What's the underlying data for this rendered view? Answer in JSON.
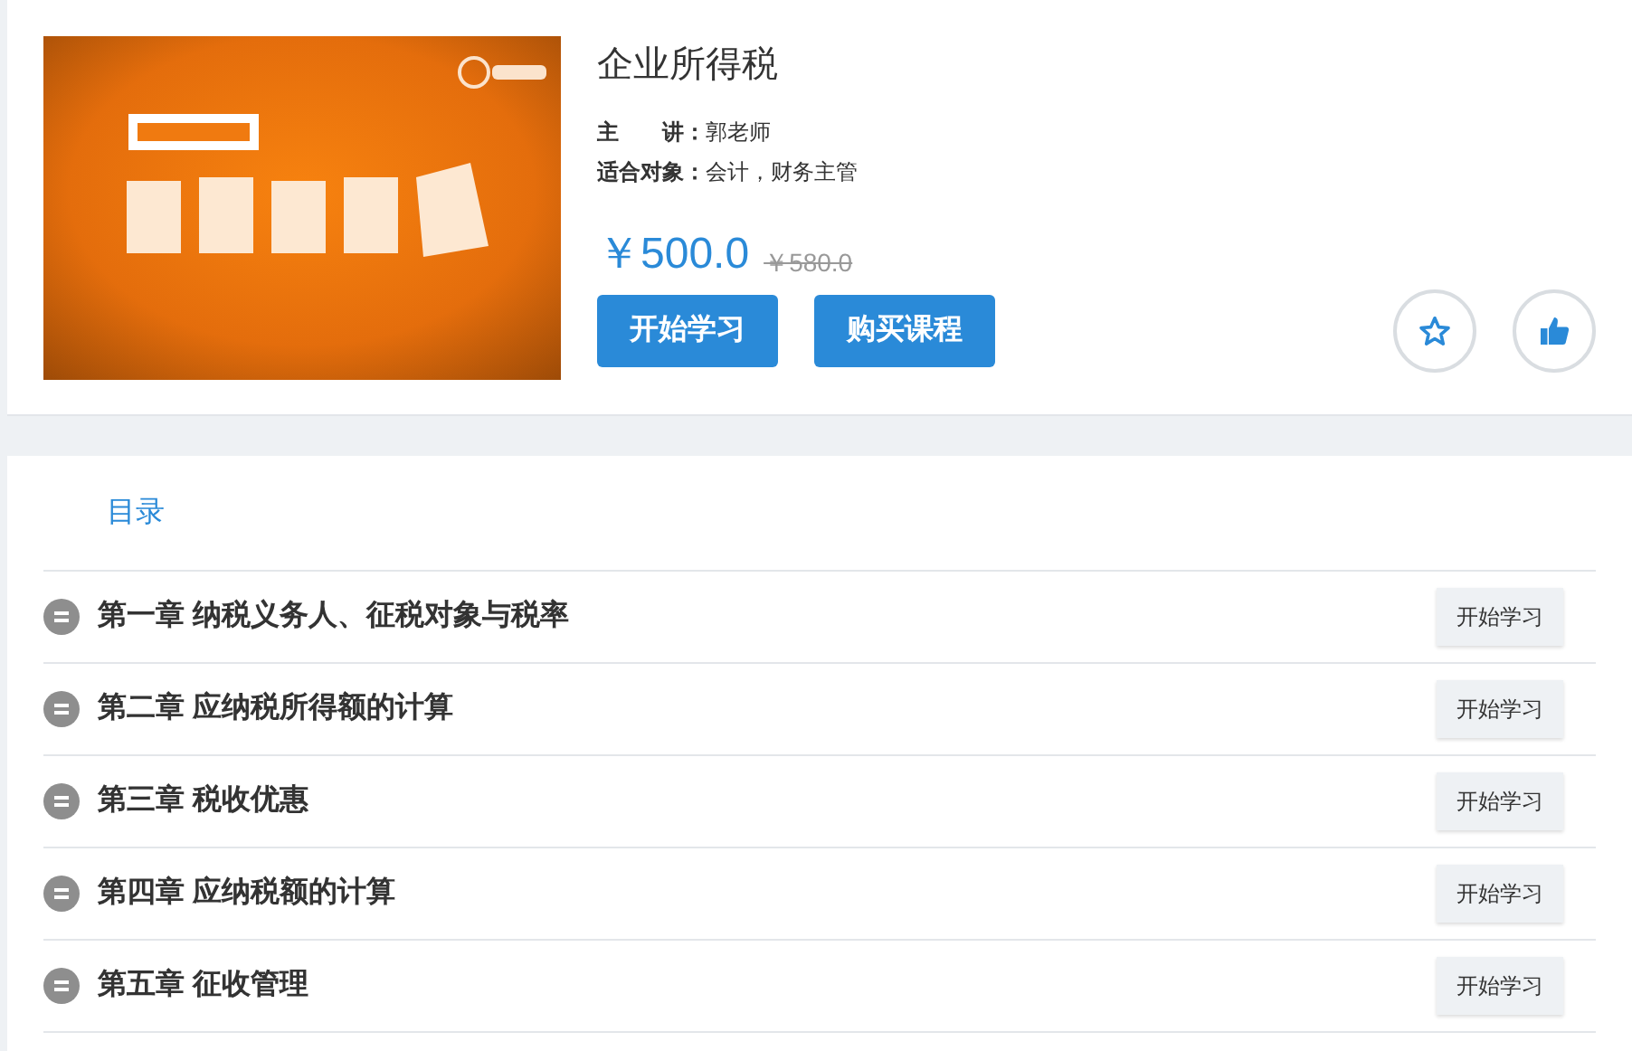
{
  "course": {
    "title": "企业所得税",
    "lecturer_label": "主　　讲：",
    "lecturer": "郭老师",
    "audience_label": "适合对象：",
    "audience": "会计，财务主管",
    "price": "￥500.0",
    "original_price": "￥580.0",
    "buttons": [
      "开始学习",
      "购买课程"
    ]
  },
  "catalog": {
    "heading": "目录",
    "chapters": [
      {
        "title": "第一章 纳税义务人、征税对象与税率",
        "action": "开始学习"
      },
      {
        "title": "第二章 应纳税所得额的计算",
        "action": "开始学习"
      },
      {
        "title": "第三章 税收优惠",
        "action": "开始学习"
      },
      {
        "title": "第四章 应纳税额的计算",
        "action": "开始学习"
      },
      {
        "title": "第五章 征收管理",
        "action": "开始学习"
      }
    ]
  }
}
